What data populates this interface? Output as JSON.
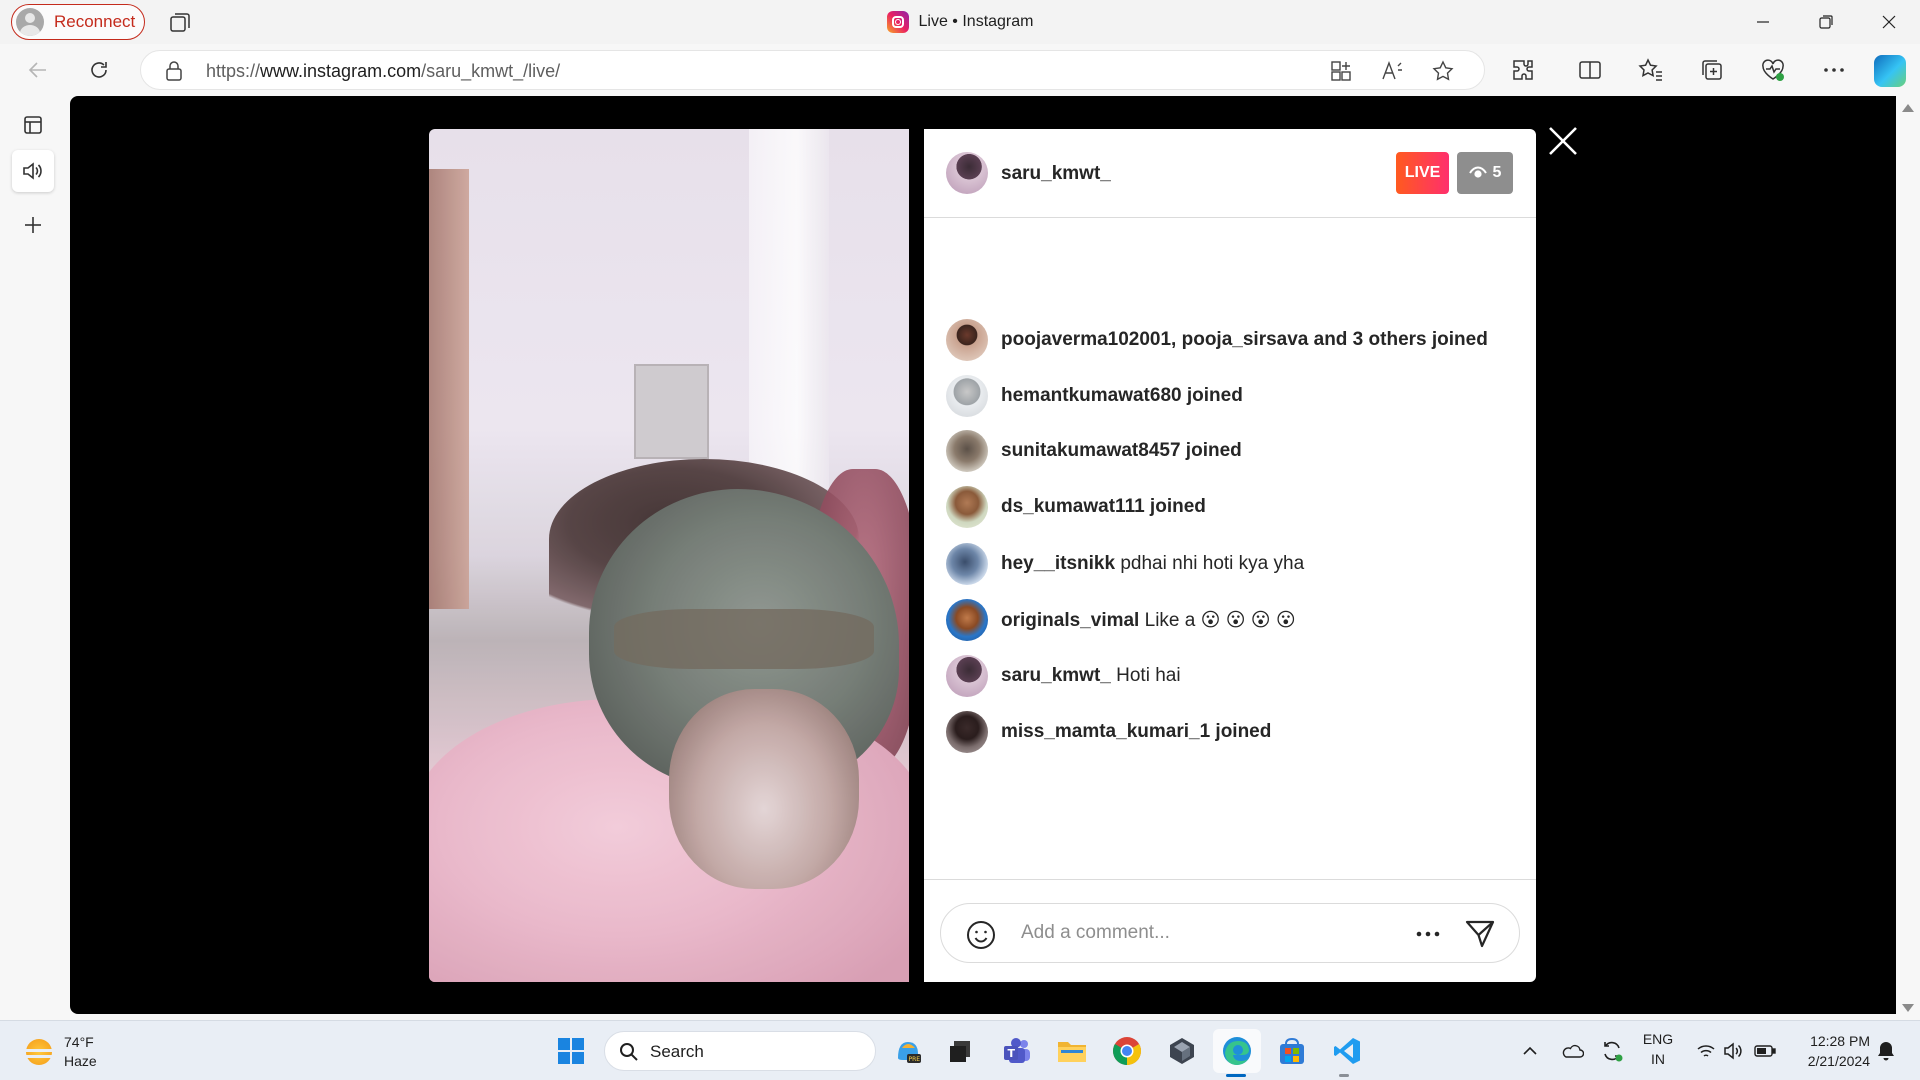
{
  "browser": {
    "reconnect_label": "Reconnect",
    "tab_title": "Live • Instagram",
    "url_prefix": "https://",
    "url_domain": "www.instagram.com",
    "url_path": "/saru_kmwt_/live/"
  },
  "live": {
    "host": "saru_kmwt_",
    "live_label": "LIVE",
    "viewer_count": "5",
    "comments": [
      {
        "user": "poojaverma102001, pooja_sirsava and 3 others joined",
        "text": ""
      },
      {
        "user": "hemantkumawat680 joined",
        "text": ""
      },
      {
        "user": "sunitakumawat8457 joined",
        "text": ""
      },
      {
        "user": "ds_kumawat111 joined",
        "text": ""
      },
      {
        "user": "hey__itsnikk",
        "text": "pdhai nhi hoti kya yha"
      },
      {
        "user": "originals_vimal",
        "text": "Like a 😮 😮 😮 😮"
      },
      {
        "user": "saru_kmwt_",
        "text": "Hoti hai"
      },
      {
        "user": "miss_mamta_kumari_1 joined",
        "text": ""
      }
    ],
    "comment_placeholder": "Add a comment..."
  },
  "taskbar": {
    "weather_temp": "74°F",
    "weather_condition": "Haze",
    "search_label": "Search",
    "lang_top": "ENG",
    "lang_bottom": "IN",
    "time": "12:28 PM",
    "date": "2/21/2024"
  },
  "colors": {
    "reconnect_red": "#c42b1c",
    "live_gradient_start": "#ff5a1f",
    "live_gradient_end": "#ff2f6d",
    "viewer_badge": "#8e8e8e",
    "accent_blue": "#0067c0"
  }
}
